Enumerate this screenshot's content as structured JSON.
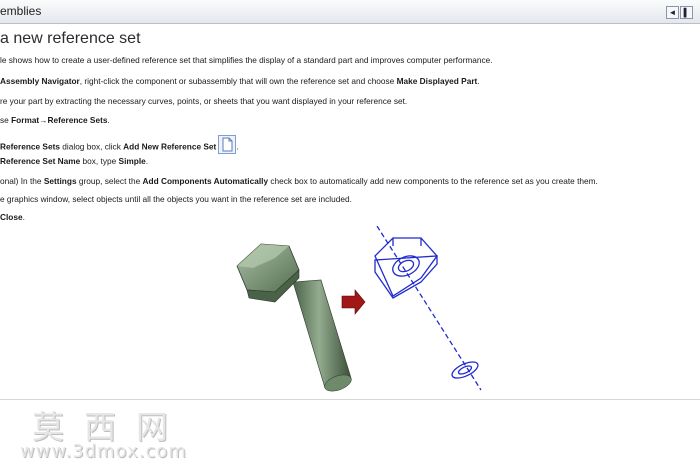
{
  "titlebar": {
    "title": "emblies",
    "back_glyph": "◄",
    "forward_glyph": "▌"
  },
  "heading": "a new reference set",
  "steps": [
    {
      "parts": [
        {
          "t": "le shows how to create a user-defined reference set that simplifies the display of a standard part and improves computer performance."
        }
      ]
    },
    {
      "parts": [
        {
          "t": "Assembly Navigator",
          "b": true
        },
        {
          "t": ", right-click the component or subassembly that will own the reference set and choose "
        },
        {
          "t": "Make Displayed Part",
          "b": true
        },
        {
          "t": "."
        }
      ]
    },
    {
      "parts": [
        {
          "t": "re your part by extracting the necessary curves, points, or sheets that you want displayed in your reference set."
        }
      ]
    },
    {
      "parts": [
        {
          "t": "se "
        },
        {
          "t": "Format→Reference Sets",
          "b": true
        },
        {
          "t": "."
        }
      ]
    },
    {
      "parts": [
        {
          "t": "Reference Sets",
          "b": true
        },
        {
          "t": " dialog box, click "
        },
        {
          "t": "Add New Reference Set",
          "b": true
        }
      ],
      "icon": "add-reference-set-icon",
      "suffix": "."
    },
    {
      "parts": [
        {
          "t": "Reference Set Name",
          "b": true
        },
        {
          "t": " box, type "
        },
        {
          "t": "Simple",
          "b": true
        },
        {
          "t": "."
        }
      ]
    },
    {
      "parts": [
        {
          "t": "onal) In the "
        },
        {
          "t": "Settings",
          "b": true
        },
        {
          "t": " group, select the "
        },
        {
          "t": "Add Components Automatically",
          "b": true
        },
        {
          "t": " check box to automatically add new components to the reference set as you create them."
        }
      ]
    },
    {
      "parts": [
        {
          "t": "e graphics window, select objects until all the objects you want in the reference set are included."
        }
      ]
    },
    {
      "parts": [
        {
          "t": "Close",
          "b": true
        },
        {
          "t": "."
        }
      ]
    }
  ],
  "colors": {
    "bolt": "#6e8a6a",
    "wireframe": "#1f2bd0",
    "arrow": "#a01818"
  },
  "watermark": {
    "cn": "莫西网",
    "url": "www.3dmox.com"
  }
}
